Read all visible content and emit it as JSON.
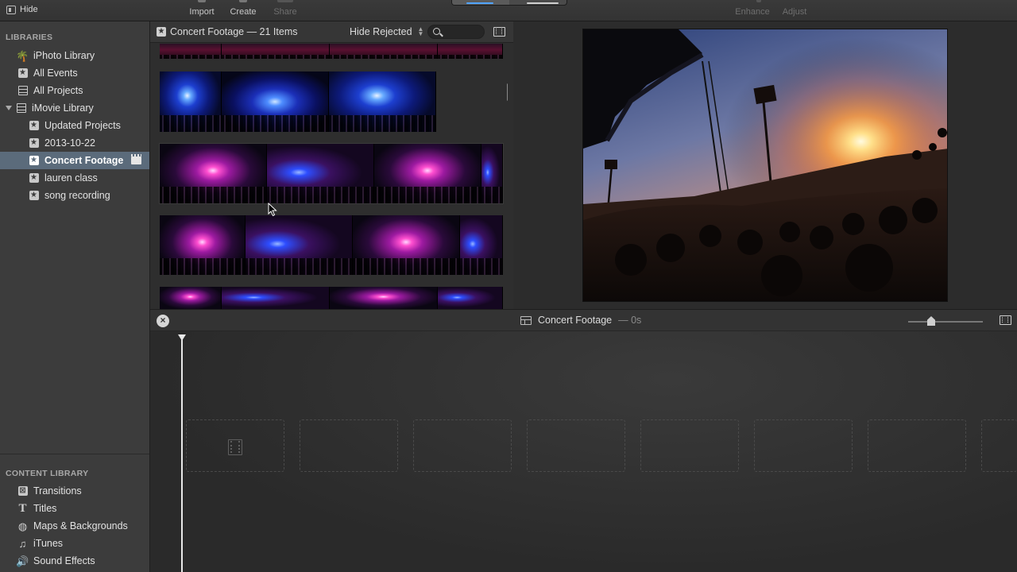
{
  "toolbar": {
    "hide_label": "Hide",
    "import_label": "Import",
    "create_label": "Create",
    "share_label": "Share",
    "enhance_label": "Enhance",
    "adjust_label": "Adjust"
  },
  "sidebar": {
    "libraries_header": "LIBRARIES",
    "items": [
      {
        "label": "iPhoto Library",
        "icon": "palm-tree-icon"
      },
      {
        "label": "All Events",
        "icon": "star-box-icon"
      },
      {
        "label": "All Projects",
        "icon": "clapper-grid-icon"
      },
      {
        "label": "iMovie Library",
        "icon": "grid-icon"
      },
      {
        "label": "Updated Projects",
        "icon": "star-box-icon"
      },
      {
        "label": "2013-10-22",
        "icon": "star-box-icon"
      },
      {
        "label": "Concert Footage",
        "icon": "star-box-icon",
        "selected": true
      },
      {
        "label": "lauren class",
        "icon": "star-box-icon"
      },
      {
        "label": "song recording",
        "icon": "star-box-icon"
      }
    ],
    "content_header": "CONTENT LIBRARY",
    "content_items": [
      {
        "label": "Transitions",
        "icon": "transitions-icon"
      },
      {
        "label": "Titles",
        "icon": "titles-icon"
      },
      {
        "label": "Maps & Backgrounds",
        "icon": "globe-icon"
      },
      {
        "label": "iTunes",
        "icon": "music-note-icon"
      },
      {
        "label": "Sound Effects",
        "icon": "speaker-icon"
      }
    ]
  },
  "browser": {
    "title": "Concert Footage — 21 Items",
    "filter_label": "Hide Rejected"
  },
  "timeline": {
    "project_title": "Concert Footage",
    "duration": "— 0s"
  },
  "colors": {
    "sidebar_bg": "#3c3c3c",
    "selection": "#5b6b7b",
    "accent_blue": "#4fa3ff"
  }
}
